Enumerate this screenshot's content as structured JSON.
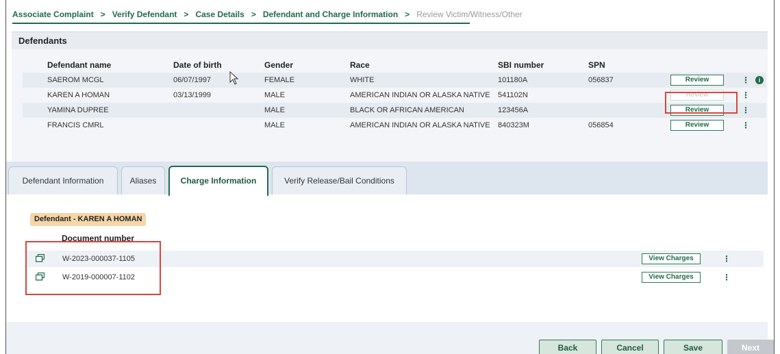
{
  "breadcrumb": {
    "items": [
      {
        "label": "Associate Complaint",
        "active": true
      },
      {
        "label": "Verify Defendant",
        "active": true
      },
      {
        "label": "Case Details",
        "active": true
      },
      {
        "label": "Defendant and Charge Information",
        "active": true
      },
      {
        "label": "Review Victim/Witness/Other",
        "active": false
      }
    ],
    "separator": ">"
  },
  "defendants": {
    "title": "Defendants",
    "columns": [
      "Defendant name",
      "Date of birth",
      "Gender",
      "Race",
      "SBI number",
      "SPN"
    ],
    "rows": [
      {
        "name": "SAEROM MCGL",
        "dob": "06/07/1997",
        "gender": "FEMALE",
        "race": "WHITE",
        "sbi": "101180A",
        "spn": "056837",
        "review": "Review",
        "review_enabled": true,
        "link": false,
        "info": "i"
      },
      {
        "name": "KAREN A HOMAN",
        "dob": "03/13/1999",
        "gender": "MALE",
        "race": "AMERICAN INDIAN OR ALASKA NATIVE",
        "sbi": "541102N",
        "spn": "",
        "review": "Review",
        "review_enabled": false,
        "link": true
      },
      {
        "name": "YAMINA DUPREE",
        "dob": "",
        "gender": "MALE",
        "race": "BLACK OR AFRICAN AMERICAN",
        "sbi": "123456A",
        "spn": "",
        "review": "Review",
        "review_enabled": true,
        "link": false
      },
      {
        "name": "FRANCIS CMRL",
        "dob": "",
        "gender": "MALE",
        "race": "AMERICAN INDIAN OR ALASKA NATIVE",
        "sbi": "840323M",
        "spn": "056854",
        "review": "Review",
        "review_enabled": true,
        "link": true
      }
    ],
    "kebab": "⋮"
  },
  "tabs": [
    {
      "label": "Defendant Information",
      "active": false
    },
    {
      "label": "Aliases",
      "active": false
    },
    {
      "label": "Charge Information",
      "active": true
    },
    {
      "label": "Verify Release/Bail Conditions",
      "active": false
    }
  ],
  "charge_info": {
    "defendant_chip": "Defendant - KAREN A HOMAN",
    "doc_header": "Document number",
    "documents": [
      {
        "number": "W-2023-000037-1105",
        "action": "View Charges"
      },
      {
        "number": "W-2019-000007-1102",
        "action": "View Charges"
      }
    ]
  },
  "footer": {
    "back": "Back",
    "cancel": "Cancel",
    "save": "Save",
    "next": "Next"
  },
  "colors": {
    "accent": "#1f6b4a",
    "highlight": "#d9443c",
    "chip": "#f5d6a8"
  }
}
